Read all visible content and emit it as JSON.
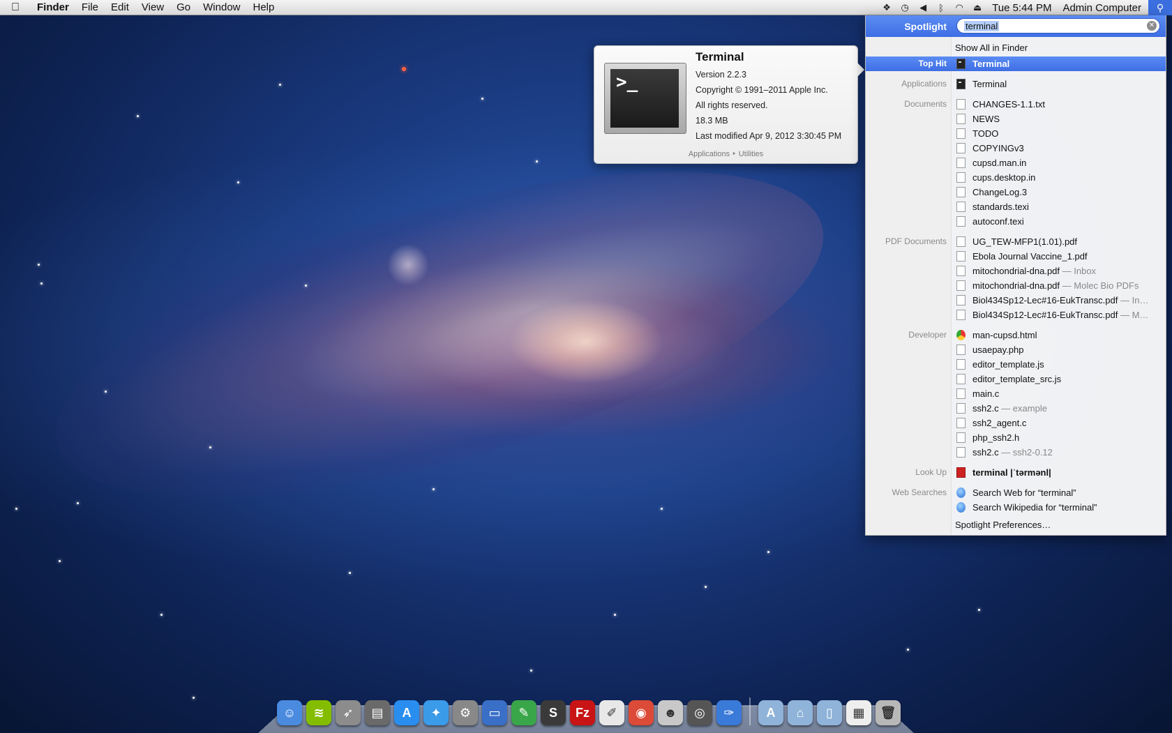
{
  "menubar": {
    "apple": "",
    "app_name": "Finder",
    "menus": [
      "File",
      "Edit",
      "View",
      "Go",
      "Window",
      "Help"
    ],
    "status_icons": [
      "dropbox-icon",
      "time-machine-icon",
      "volume-icon",
      "bluetooth-icon",
      "wifi-icon",
      "eject-icon"
    ],
    "clock": "Tue 5:44 PM",
    "user": "Admin Computer"
  },
  "spotlight": {
    "title": "Spotlight",
    "query": "terminal",
    "show_all": "Show All in Finder",
    "top_hit": {
      "category": "Top Hit",
      "label": "Terminal"
    },
    "applications": {
      "category": "Applications",
      "items": [
        "Terminal"
      ]
    },
    "documents": {
      "category": "Documents",
      "items": [
        "CHANGES-1.1.txt",
        "NEWS",
        "TODO",
        "COPYINGv3",
        "cupsd.man.in",
        "cups.desktop.in",
        "ChangeLog.3",
        "standards.texi",
        "autoconf.texi"
      ]
    },
    "pdf_documents": {
      "category": "PDF Documents",
      "items": [
        {
          "name": "UG_TEW-MFP1(1.01).pdf",
          "suffix": ""
        },
        {
          "name": "Ebola Journal Vaccine_1.pdf",
          "suffix": ""
        },
        {
          "name": "mitochondrial-dna.pdf",
          "suffix": " — Inbox"
        },
        {
          "name": "mitochondrial-dna.pdf",
          "suffix": " — Molec Bio PDFs"
        },
        {
          "name": "Biol434Sp12-Lec#16-EukTransc.pdf",
          "suffix": " — In…"
        },
        {
          "name": "Biol434Sp12-Lec#16-EukTransc.pdf",
          "suffix": " — M…"
        }
      ]
    },
    "developer": {
      "category": "Developer",
      "items": [
        {
          "name": "man-cupsd.html",
          "suffix": ""
        },
        {
          "name": "usaepay.php",
          "suffix": ""
        },
        {
          "name": "editor_template.js",
          "suffix": ""
        },
        {
          "name": "editor_template_src.js",
          "suffix": ""
        },
        {
          "name": "main.c",
          "suffix": ""
        },
        {
          "name": "ssh2.c",
          "suffix": " — example"
        },
        {
          "name": "ssh2_agent.c",
          "suffix": ""
        },
        {
          "name": "php_ssh2.h",
          "suffix": ""
        },
        {
          "name": "ssh2.c",
          "suffix": " — ssh2-0.12"
        }
      ]
    },
    "look_up": {
      "category": "Look Up",
      "label": "terminal |ˈtərmənl|"
    },
    "web_searches": {
      "category": "Web Searches",
      "items": [
        "Search Web for “terminal”",
        "Search Wikipedia for “terminal”"
      ]
    },
    "preferences": "Spotlight Preferences…"
  },
  "preview": {
    "name": "Terminal",
    "prompt": ">_",
    "version": "Version 2.2.3",
    "copyright": "Copyright © 1991–2011 Apple Inc.",
    "rights": "All rights reserved.",
    "size": "18.3 MB",
    "modified": "Last modified Apr 9, 2012 3:30:45 PM",
    "path": "Applications ‣ Utilities"
  },
  "dock": {
    "items": [
      {
        "name": "finder",
        "glyph": "☺",
        "color": "#4a8be0"
      },
      {
        "name": "spotify",
        "glyph": "≋",
        "color": "#84bd00"
      },
      {
        "name": "launchpad",
        "glyph": "➶",
        "color": "#8c8c8c"
      },
      {
        "name": "photo-browser",
        "glyph": "▤",
        "color": "#6a6a6a"
      },
      {
        "name": "app-store",
        "glyph": "A",
        "color": "#2a8ef0"
      },
      {
        "name": "safari",
        "glyph": "✦",
        "color": "#3a9be8"
      },
      {
        "name": "system-preferences",
        "glyph": "⚙",
        "color": "#888888"
      },
      {
        "name": "keynote",
        "glyph": "▭",
        "color": "#3a6fc8"
      },
      {
        "name": "evernote",
        "glyph": "✎",
        "color": "#3aa64a"
      },
      {
        "name": "sublime-text",
        "glyph": "S",
        "color": "#3a3a3a"
      },
      {
        "name": "filezilla",
        "glyph": "Fz",
        "color": "#c81414"
      },
      {
        "name": "textedit",
        "glyph": "✐",
        "color": "#e8e8e8"
      },
      {
        "name": "chrome",
        "glyph": "◉",
        "color": "#dc4a38"
      },
      {
        "name": "contacts",
        "glyph": "☻",
        "color": "#c8c8c8"
      },
      {
        "name": "camera-app",
        "glyph": "◎",
        "color": "#555555"
      },
      {
        "name": "xcode",
        "glyph": "✑",
        "color": "#3a7ad8"
      }
    ],
    "right_items": [
      {
        "name": "applications-folder",
        "glyph": "A",
        "color": "#8fb3d9"
      },
      {
        "name": "documents-folder",
        "glyph": "⌂",
        "color": "#8fb3d9"
      },
      {
        "name": "downloads-folder",
        "glyph": "▯",
        "color": "#8fb3d9"
      },
      {
        "name": "sql-file",
        "glyph": "▦",
        "color": "#eeeeee"
      },
      {
        "name": "trash",
        "glyph": "🗑",
        "color": "#b8b8b8"
      }
    ]
  }
}
